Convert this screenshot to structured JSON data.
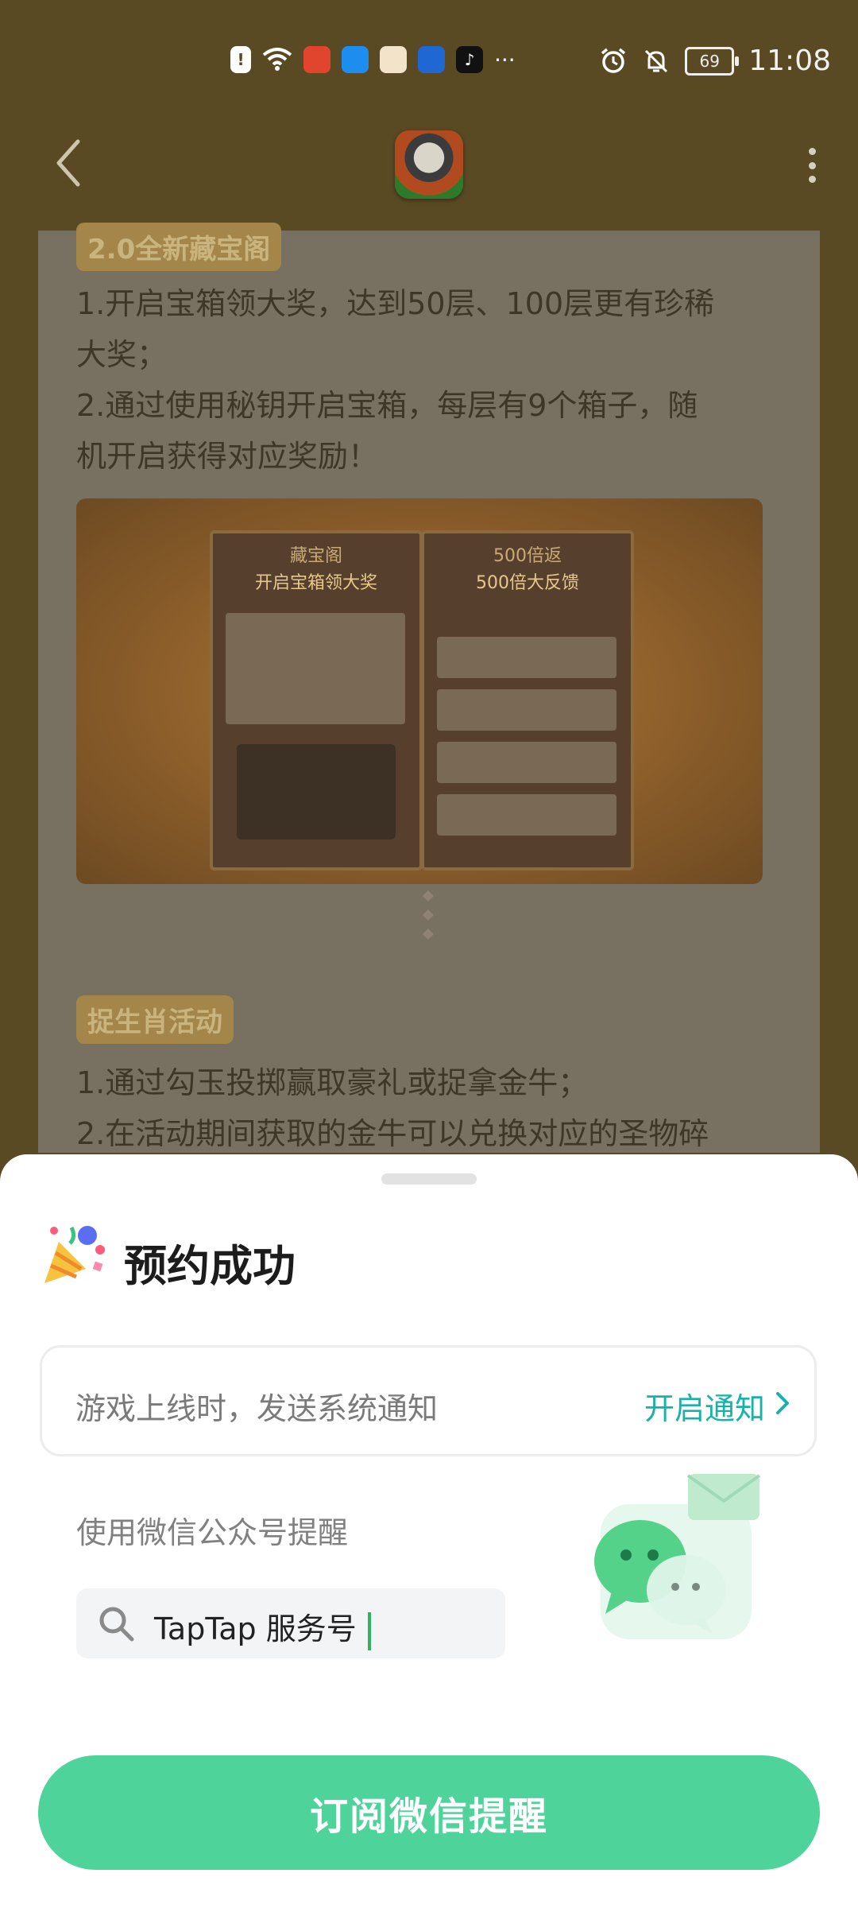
{
  "status_bar": {
    "time": "11:08",
    "battery": "69",
    "left_icons": [
      "alert-icon",
      "wifi-icon",
      "app-icon-red",
      "app-icon-blue",
      "app-icon-mascot",
      "app-icon-autohome",
      "app-icon-tiktok"
    ],
    "more": "···",
    "right_icons": [
      "alarm-icon",
      "bell-muted-icon"
    ]
  },
  "article": {
    "section1_tag": "2.0全新藏宝阁",
    "section1_lines": [
      "1.开启宝箱领大奖，达到50层、100层更有珍稀",
      "大奖；",
      "2.通过使用秘钥开启宝箱，每层有9个箱子，随",
      "机开启获得对应奖励！"
    ],
    "banner": {
      "left_title": "藏宝阁",
      "right_title": "500倍返",
      "left_heading": "开启宝箱领大奖",
      "right_heading": "500倍大反馈"
    },
    "section2_tag": "捉生肖活动",
    "section2_lines": [
      "1.通过勾玉投掷赢取豪礼或捉拿金牛；",
      "2.在活动期间获取的金牛可以兑换对应的圣物碎"
    ]
  },
  "sheet": {
    "title": "预约成功",
    "notify_text": "游戏上线时，发送系统通知",
    "notify_action": "开启通知",
    "wechat_label": "使用微信公众号提醒",
    "search_text": "TapTap 服务号",
    "subscribe_label": "订阅微信提醒"
  },
  "colors": {
    "accent_green": "#4ED39B",
    "accent_teal": "#18B2A8",
    "overlay_bg": "#5A4A24"
  }
}
